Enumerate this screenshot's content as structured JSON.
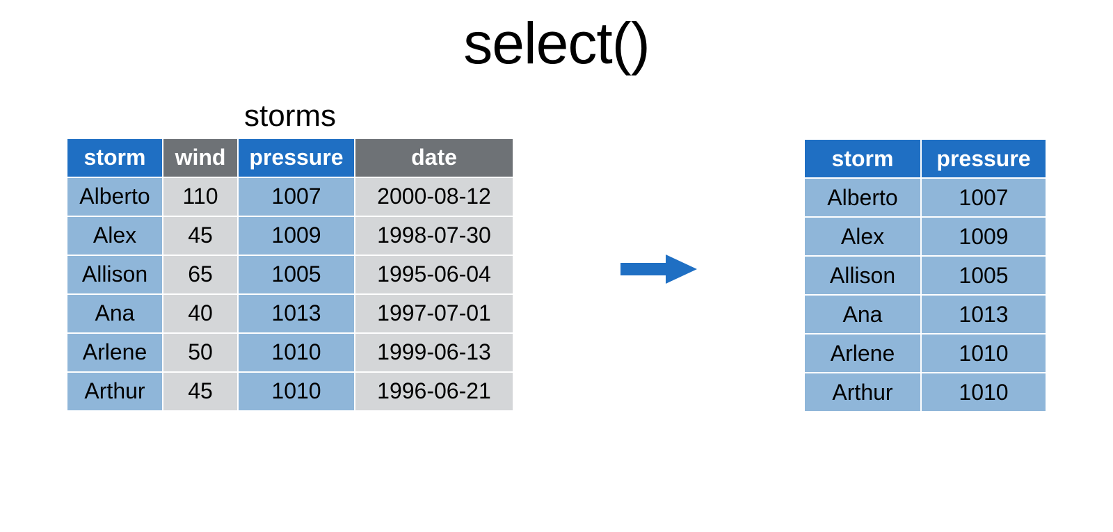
{
  "title": "select()",
  "left_table": {
    "caption": "storms",
    "headers": [
      "storm",
      "wind",
      "pressure",
      "date"
    ],
    "rows": [
      [
        "Alberto",
        "110",
        "1007",
        "2000-08-12"
      ],
      [
        "Alex",
        "45",
        "1009",
        "1998-07-30"
      ],
      [
        "Allison",
        "65",
        "1005",
        "1995-06-04"
      ],
      [
        "Ana",
        "40",
        "1013",
        "1997-07-01"
      ],
      [
        "Arlene",
        "50",
        "1010",
        "1999-06-13"
      ],
      [
        "Arthur",
        "45",
        "1010",
        "1996-06-21"
      ]
    ]
  },
  "right_table": {
    "headers": [
      "storm",
      "pressure"
    ],
    "rows": [
      [
        "Alberto",
        "1007"
      ],
      [
        "Alex",
        "1009"
      ],
      [
        "Allison",
        "1005"
      ],
      [
        "Ana",
        "1013"
      ],
      [
        "Arlene",
        "1010"
      ],
      [
        "Arthur",
        "1010"
      ]
    ]
  },
  "colors": {
    "header_blue": "#1f6fc3",
    "header_gray": "#6e7276",
    "cell_blue": "#8fb6d9",
    "cell_gray": "#d4d6d8",
    "arrow": "#1f6fc3"
  }
}
